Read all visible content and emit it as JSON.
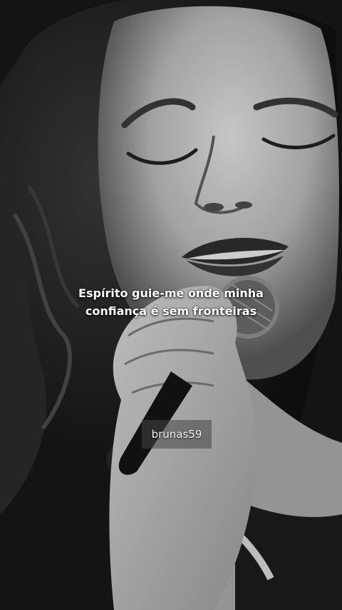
{
  "caption": {
    "line1": "Espírito guie-me onde minha",
    "line2": "confiança é sem fronteiras"
  },
  "watermark": {
    "username": "brunas59"
  },
  "colors": {
    "caption_text": "#ffffff",
    "background": "#121212"
  },
  "photo": {
    "subject_icon": "singer-with-microphone"
  }
}
